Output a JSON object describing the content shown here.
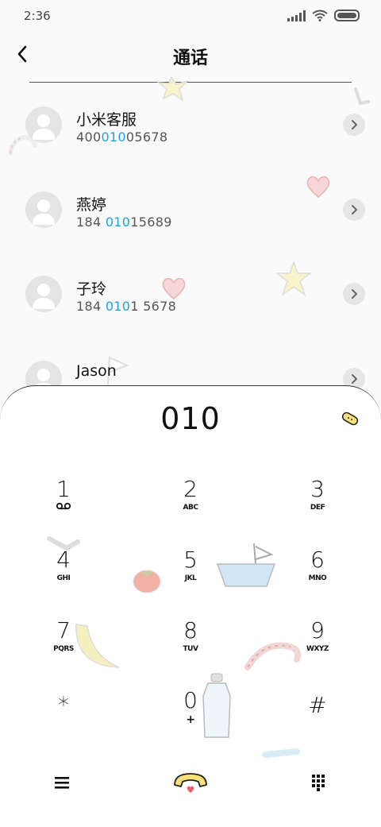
{
  "status": {
    "time": "2:36"
  },
  "header": {
    "title": "通话"
  },
  "contacts": [
    {
      "name": "小米客服",
      "pre": "400",
      "hl": "010",
      "post": "05678"
    },
    {
      "name": "燕婷",
      "pre": "184 ",
      "hl": "010",
      "post": "15689"
    },
    {
      "name": "子玲",
      "pre": "184 ",
      "hl": "010",
      "post": "1 5678"
    },
    {
      "name": "Jason",
      "pre": "",
      "hl": "",
      "post": ""
    }
  ],
  "dialer": {
    "input": "010",
    "keys": [
      {
        "digit": "1",
        "letters": "ꝏ"
      },
      {
        "digit": "2",
        "letters": "ABC"
      },
      {
        "digit": "3",
        "letters": "DEF"
      },
      {
        "digit": "4",
        "letters": "GHI"
      },
      {
        "digit": "5",
        "letters": "JKL"
      },
      {
        "digit": "6",
        "letters": "MNO"
      },
      {
        "digit": "7",
        "letters": "PQRS"
      },
      {
        "digit": "8",
        "letters": "TUV"
      },
      {
        "digit": "9",
        "letters": "WXYZ"
      },
      {
        "digit": "*",
        "letters": ""
      },
      {
        "digit": "0",
        "letters": "+"
      },
      {
        "digit": "#",
        "letters": ""
      }
    ]
  },
  "icons": {
    "back": "chevron-left-icon",
    "menu": "hamburger-menu-icon",
    "call": "phone-handset-icon",
    "keypad": "dialpad-icon",
    "voicemail": "voicemail-icon"
  },
  "colors": {
    "highlight": "#1aa3e8",
    "call_button": "#f7e27a"
  }
}
